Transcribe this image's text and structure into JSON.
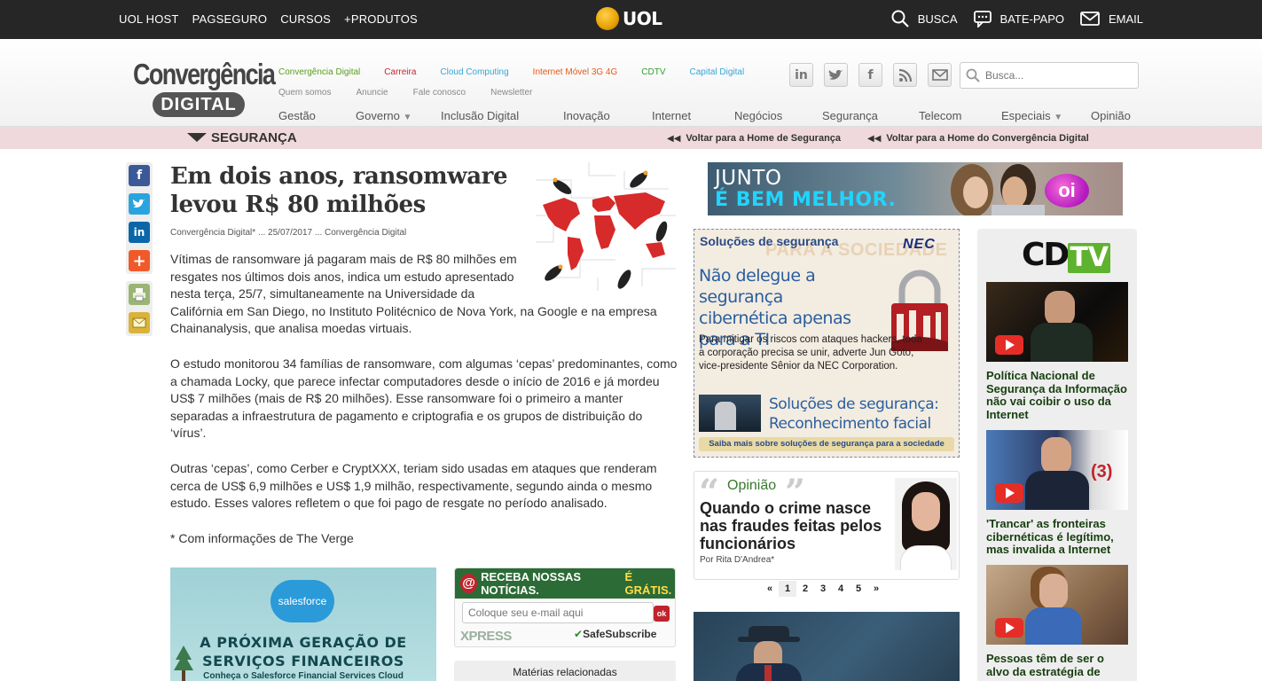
{
  "uolbar": {
    "left_links": [
      "UOL HOST",
      "PAGSEGURO",
      "CURSOS",
      "+PRODUTOS"
    ],
    "logo_text": "UOL",
    "busca": "BUSCA",
    "batepapo": "BATE-PAPO",
    "email": "EMAIL"
  },
  "brand": {
    "line1": "Convergência",
    "line2": "DIGITAL"
  },
  "subnav": [
    {
      "label": "Convergência Digital",
      "color": "#5b9e1e"
    },
    {
      "label": "Carreira",
      "color": "#c2262e"
    },
    {
      "label": "Cloud Computing",
      "color": "#35a6d6"
    },
    {
      "label": "Internet Móvel 3G 4G",
      "color": "#e55a17"
    },
    {
      "label": "CDTV",
      "color": "#2f9f2f"
    },
    {
      "label": "Capital Digital",
      "color": "#35a6d6"
    }
  ],
  "utilnav": [
    "Quem somos",
    "Anuncie",
    "Fale conosco",
    "Newsletter"
  ],
  "mainnav": [
    "Gestão",
    "Governo",
    "Inclusão Digital",
    "Inovação",
    "Internet",
    "Negócios",
    "Segurança",
    "Telecom",
    "Especiais",
    "Opinião"
  ],
  "social": [
    "linkedin-icon",
    "twitter-icon",
    "facebook-icon",
    "rss-icon",
    "mail-icon"
  ],
  "search": {
    "placeholder": "Busca..."
  },
  "section": {
    "title": "SEGURANÇA",
    "back1": "Voltar para a Home de Segurança",
    "back2": "Voltar para a Home do Convergência Digital"
  },
  "share": [
    "facebook-icon",
    "twitter-icon",
    "linkedin-icon",
    "plus-icon",
    "print-icon",
    "email-icon"
  ],
  "article": {
    "title": "Em dois anos, ransomware levou R$ 80 milhões",
    "byline": "Convergência Digital* ... 25/07/2017 ... Convergência Digital",
    "p1_lines": [
      "Vítimas de ransomware já pagaram mais de R$ 80 milhões em",
      "resgates nos últimos dois anos, indica um estudo apresentado",
      "nesta terça, 25/7, simultaneamente na Universidade da"
    ],
    "p1_tail": "Califórnia em San Diego, no Instituto Politécnico de Nova York, na Google e na empresa Chainanalysis, que analisa moedas virtuais.",
    "p2": "O estudo monitorou 34 famílias de ransomware, com algumas ‘cepas’ predominantes, como a chamada Locky, que parece infectar computadores desde o início de 2016 e já mordeu US$ 7 milhões (mais de R$ 20 milhões). Esse ransomware foi o primeiro a manter separadas a infraestrutura de pagamento e criptografia e os grupos de distribuição do ‘vírus’.",
    "p3": "Outras ‘cepas’, como Cerber e CryptXXX, teriam sido usadas em ataques que renderam cerca de US$ 6,9 milhões e US$ 1,9 milhão, respectivamente, segundo ainda o mesmo estudo. Esses valores refletem o que foi pago de resgate no período analisado.",
    "p4": "* Com informações de The Verge"
  },
  "sfad": {
    "logo": "salesforce",
    "headline1": "A PRÓXIMA GERAÇÃO DE",
    "headline2": "SERVIÇOS FINANCEIROS",
    "sub": "Conheça o Salesforce Financial Services Cloud"
  },
  "newsletter": {
    "at": "@",
    "label": "RECEBA NOSSAS NOTÍCIAS.",
    "free": "É GRÁTIS.",
    "placeholder": "Coloque seu e-mail aqui",
    "ok": "ok",
    "brand": "XPRESS",
    "safe": "SafeSubscribe"
  },
  "related": "Matérias relacionadas",
  "oiad": {
    "line1": "JUNTO",
    "line2": "É BEM MELHOR.",
    "logo": "oi"
  },
  "necbox": {
    "kicker": "Soluções de segurança",
    "bgtext": "PARA A SOCIEDADE",
    "brand": "NEC",
    "headline": "Não delegue a segurança cibernética apenas para a TI",
    "body": "Para mitigar os riscos com ataques hackers, toda a corporação precisa se unir, adverte Jun Goto, vice-presidente Sênior da NEC Corporation.",
    "sub": "Soluções de segurança: Reconhecimento facial",
    "strip": "Saiba mais sobre soluções de segurança para a sociedade"
  },
  "opiniao": {
    "label": "Opinião",
    "title": "Quando o crime nasce nas fraudes feitas pelos funcionários",
    "author": "Por Rita D'Andrea*"
  },
  "pager": [
    "«",
    "1",
    "2",
    "3",
    "4",
    "5",
    "»"
  ],
  "cdtv": {
    "logo_cd": "CD",
    "logo_tv": "TV",
    "videos": [
      {
        "title": "Política Nacional de Segurança da Informação não vai coibir o uso da Internet"
      },
      {
        "title": "'Trancar' as fronteiras cibernéticas é legítimo, mas invalida a Internet"
      },
      {
        "title": "Pessoas têm de ser o alvo da estratégia de"
      }
    ]
  }
}
